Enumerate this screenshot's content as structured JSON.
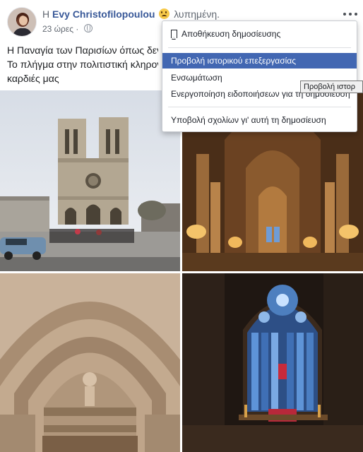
{
  "post": {
    "author_prefix": "Η",
    "author_name": "Evy Christofilopoulou",
    "feeling_icon": "sad-face-emoji",
    "feeling_text": "λυπημένη.",
    "timestamp": "23 ώρες",
    "audience_icon": "globe-icon",
    "text_lines": [
      "Η Παναγία των Παρισίων όπως δεν",
      "Το πλήγμα στην πολιτιστική κληρον",
      "καρδιές μας"
    ],
    "photos": [
      {
        "label": "notre-dame-facade-photo"
      },
      {
        "label": "notre-dame-nave-interior-photo"
      },
      {
        "label": "portal-sculpture-photo"
      },
      {
        "label": "rose-window-altar-photo"
      }
    ]
  },
  "menu": {
    "save_label": "Αποθήκευση δημοσίευσης",
    "history_label": "Προβολή ιστορικού επεξεργασίας",
    "embed_label": "Ενσωμάτωση",
    "notifications_label": "Ενεργοποίηση ειδοποιήσεων για τη δημοσίευση",
    "feedback_label": "Υποβολή σχολίων γι' αυτή τη δημοσίευση"
  },
  "tooltip": {
    "text": "Προβολή ιστορ"
  },
  "colors": {
    "link": "#385898",
    "menu_highlight": "#4267b2",
    "muted": "#606770"
  }
}
